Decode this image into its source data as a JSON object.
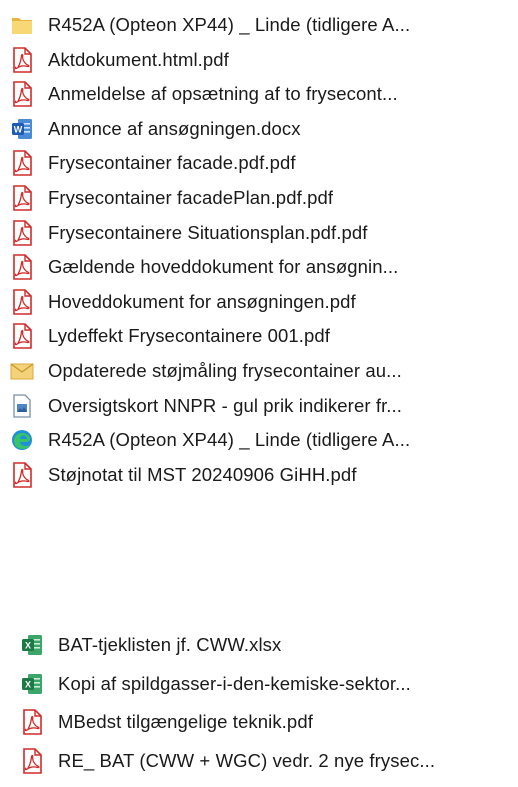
{
  "group1": [
    {
      "label": "R452A (Opteon XP44) _ Linde (tidligere A...",
      "icon": "folder-icon"
    },
    {
      "label": "Aktdokument.html.pdf",
      "icon": "pdf-icon"
    },
    {
      "label": "Anmeldelse af opsætning af to frysecont...",
      "icon": "pdf-icon"
    },
    {
      "label": "Annonce af ansøgningen.docx",
      "icon": "word-icon"
    },
    {
      "label": "Frysecontainer facade.pdf.pdf",
      "icon": "pdf-icon"
    },
    {
      "label": "Frysecontainer facadePlan.pdf.pdf",
      "icon": "pdf-icon"
    },
    {
      "label": "Frysecontainere Situationsplan.pdf.pdf",
      "icon": "pdf-icon"
    },
    {
      "label": "Gældende hoveddokument for ansøgnin...",
      "icon": "pdf-icon"
    },
    {
      "label": "Hoveddokument for ansøgningen.pdf",
      "icon": "pdf-icon"
    },
    {
      "label": "Lydeffekt Frysecontainere 001.pdf",
      "icon": "pdf-icon"
    },
    {
      "label": "Opdaterede støjmåling frysecontainer au...",
      "icon": "mail-icon"
    },
    {
      "label": "Oversigtskort NNPR - gul prik indikerer fr...",
      "icon": "image-icon"
    },
    {
      "label": "R452A (Opteon XP44) _ Linde (tidligere A...",
      "icon": "edge-icon"
    },
    {
      "label": "Støjnotat til MST 20240906 GiHH.pdf",
      "icon": "pdf-icon"
    }
  ],
  "group2": [
    {
      "label": "BAT-tjeklisten jf. CWW.xlsx",
      "icon": "excel-icon"
    },
    {
      "label": "Kopi af spildgasser-i-den-kemiske-sektor...",
      "icon": "excel-icon"
    },
    {
      "label": "MBedst tilgængelige teknik.pdf",
      "icon": "pdf-icon"
    },
    {
      "label": "RE_ BAT (CWW + WGC) vedr. 2 nye frysec...",
      "icon": "pdf-icon"
    }
  ]
}
